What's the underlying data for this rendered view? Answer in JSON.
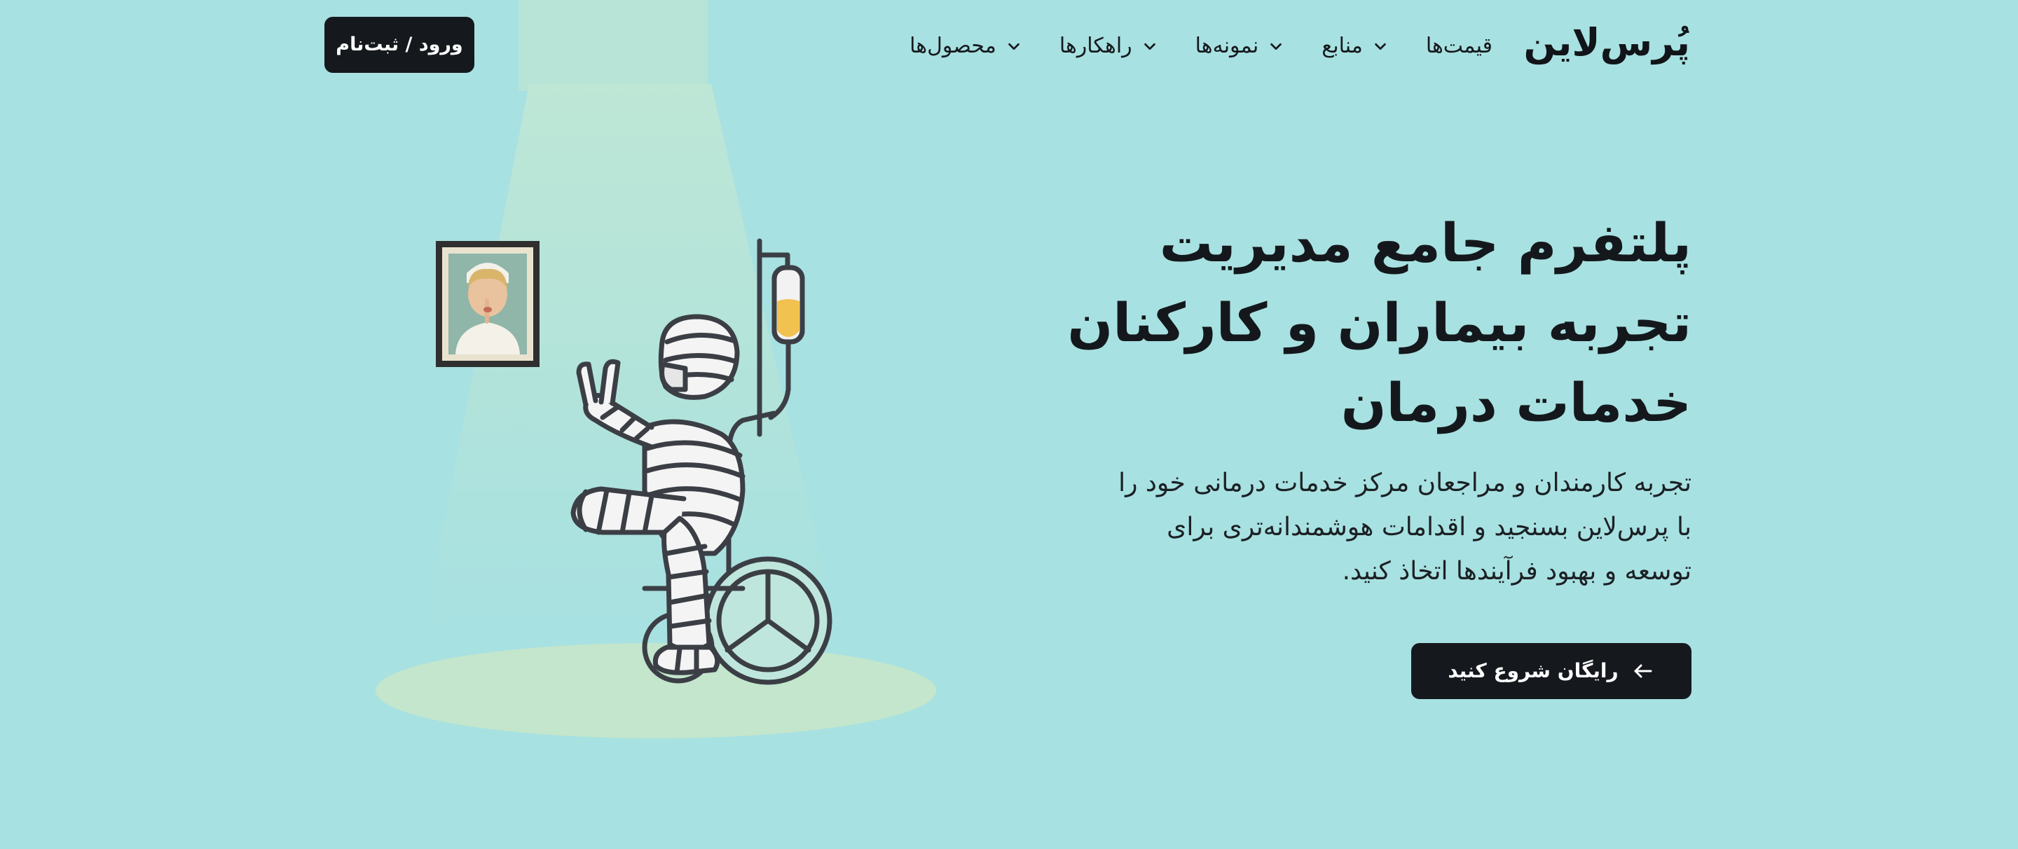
{
  "brand": {
    "logo_text": "پُرس‌لاین"
  },
  "nav": {
    "items": [
      {
        "label": "محصول‌ها",
        "has_dropdown": true
      },
      {
        "label": "راهکارها",
        "has_dropdown": true
      },
      {
        "label": "نمونه‌ها",
        "has_dropdown": true
      },
      {
        "label": "منابع",
        "has_dropdown": true
      },
      {
        "label": "قیمت‌ها",
        "has_dropdown": false
      }
    ],
    "login_label": "ورود / ثبت‌نام"
  },
  "hero": {
    "title_lines": [
      "پلتفرم جامع مدیریت",
      "تجربه بیماران و کارکنان",
      "خدمات درمان"
    ],
    "description_lines": [
      "تجربه کارمندان و مراجعان مرکز خدمات درمانی خود را",
      "با پرس‌لاین بسنجید و اقدامات هوشمندانه‌تری برای",
      "توسعه و بهبود فرآیندها اتخاذ کنید."
    ],
    "cta_label": "رایگان شروع کنید",
    "cta_icon": "arrow-left-icon"
  },
  "illustration": {
    "subject": "patient-in-wheelchair-illustration",
    "frame": "nurse-portrait-frame",
    "iv": "iv-drip-icon"
  },
  "colors": {
    "background": "#a8e1e1",
    "dark": "#15191d",
    "button_text": "#ffffff",
    "spotlight": "#c2ead6",
    "floor": "#c3e6cc",
    "iv_fluid": "#f2c250",
    "outline": "#3b3f45"
  }
}
